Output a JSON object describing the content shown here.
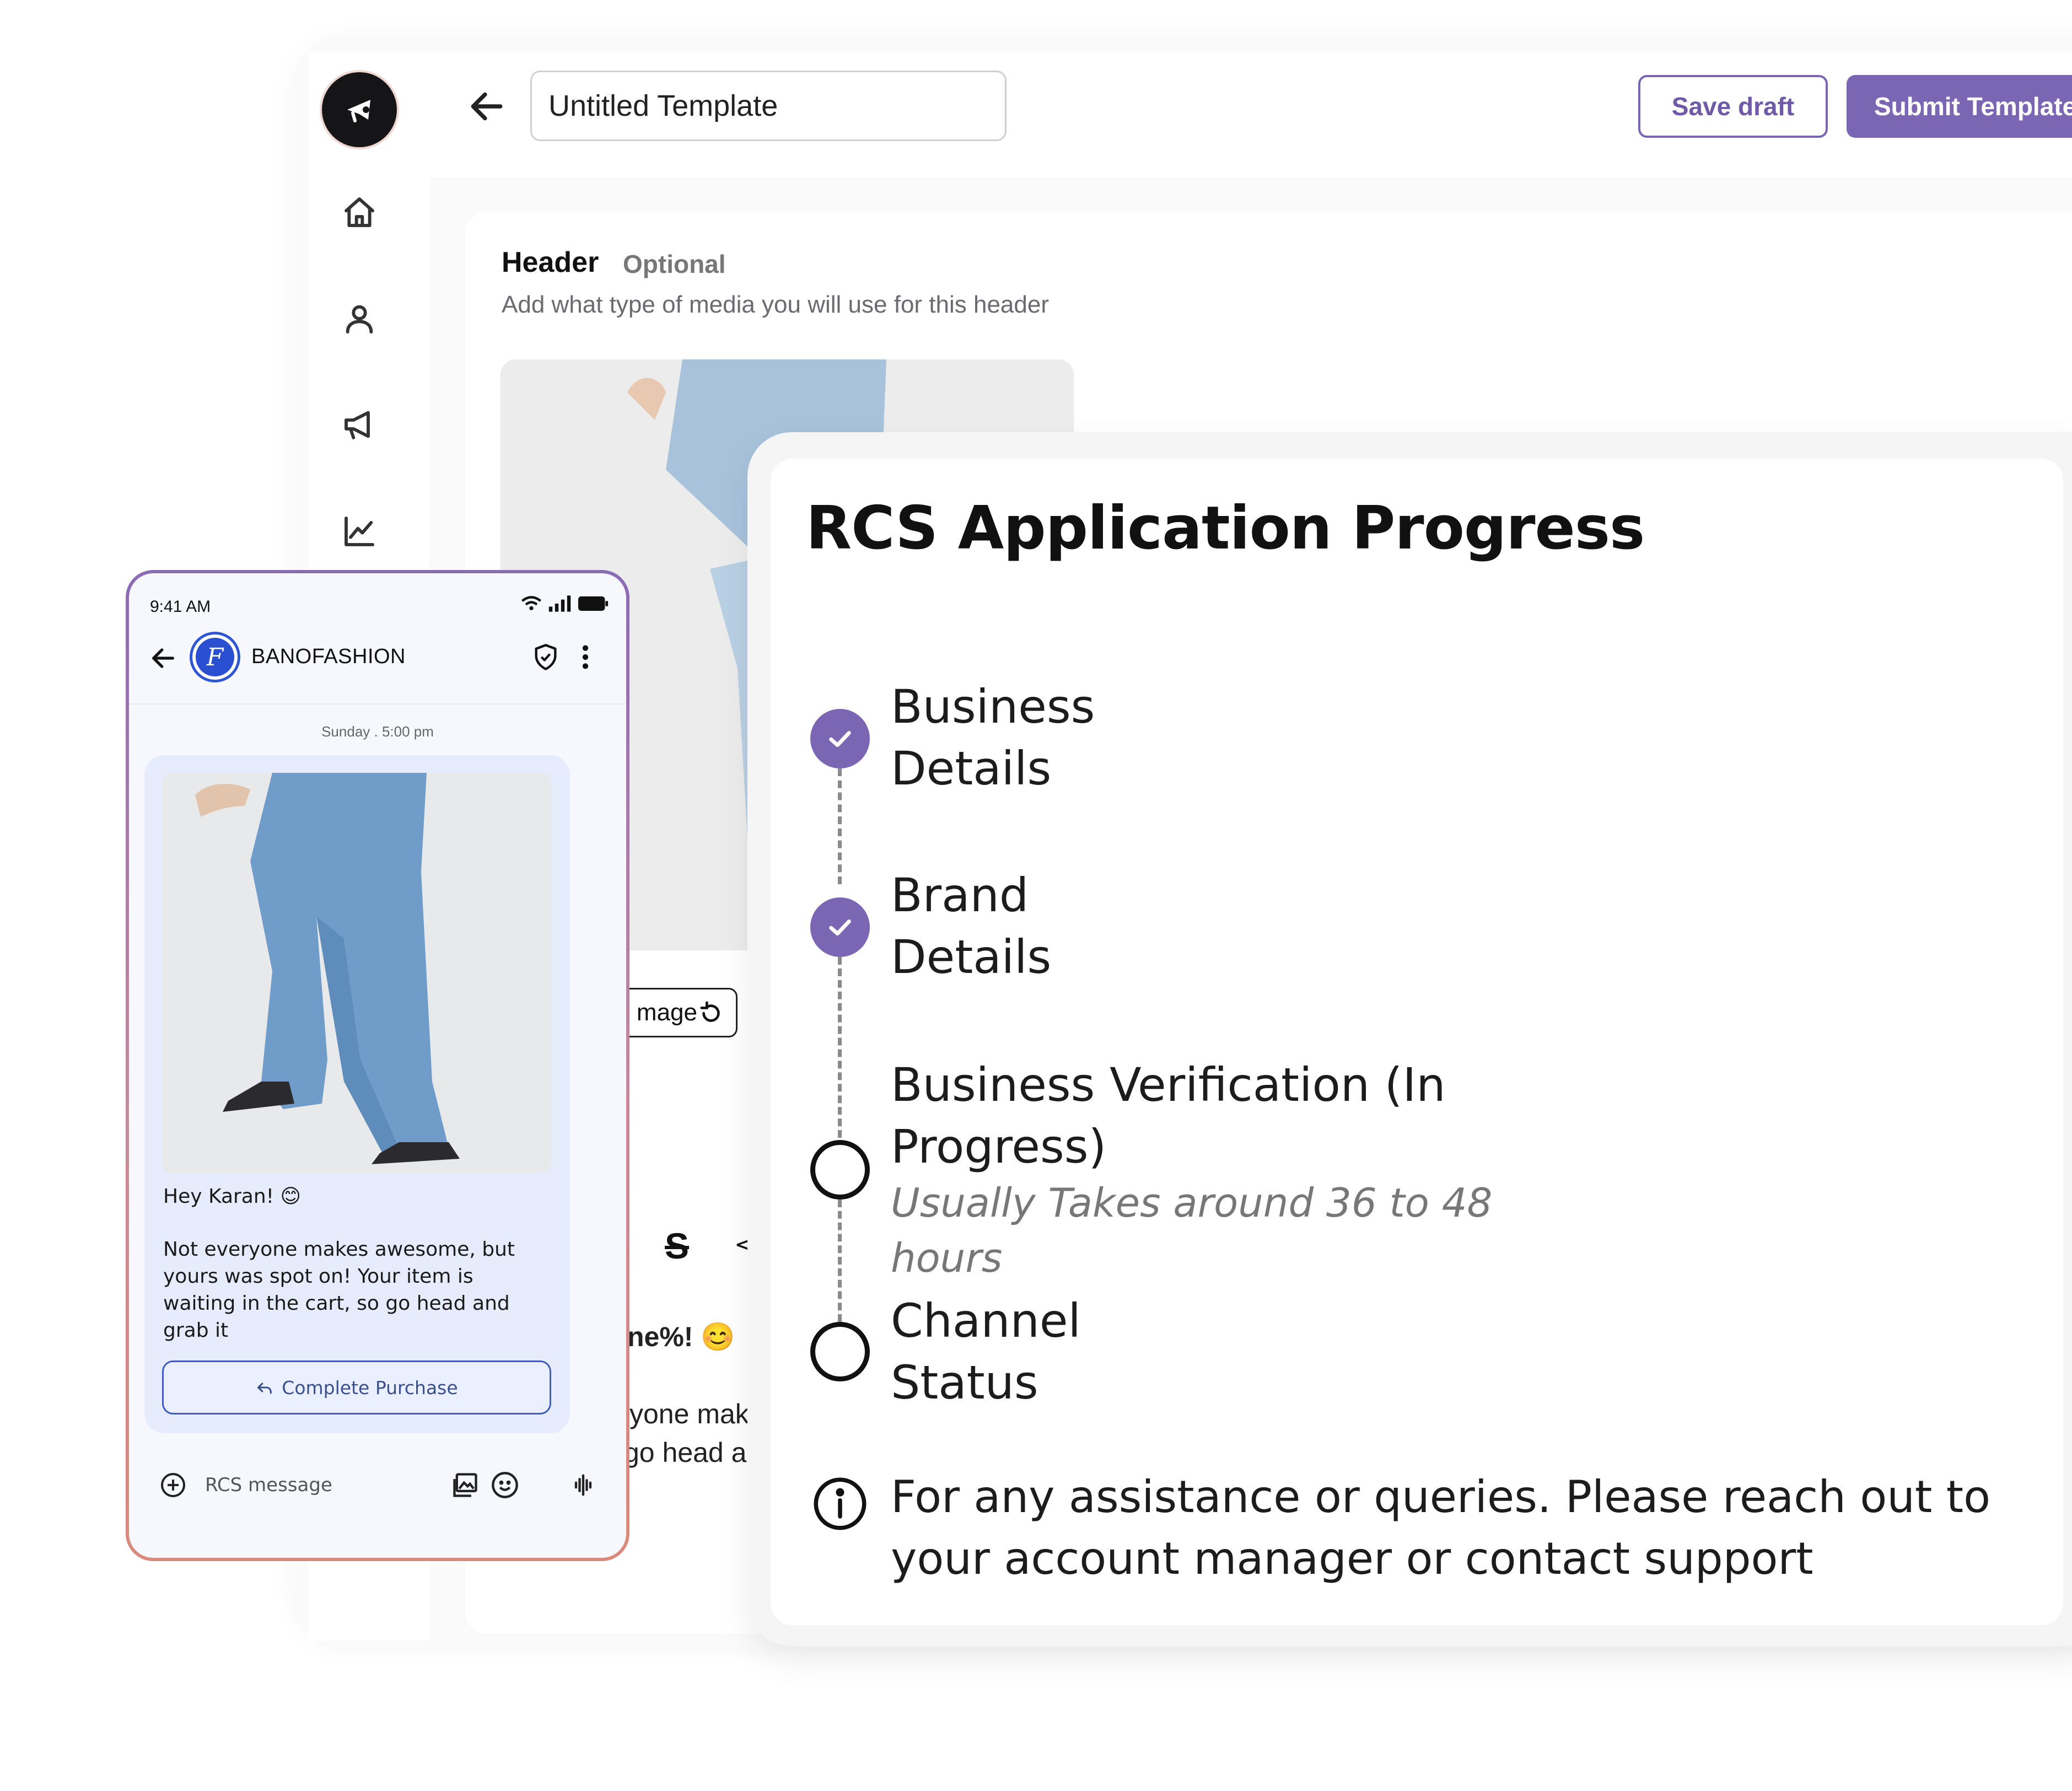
{
  "app": {
    "title_input_value": "Untitled Template",
    "save_draft_label": "Save draft",
    "submit_template_label": "Submit Template",
    "sidebar_icons": [
      "home-icon",
      "user-icon",
      "megaphone-icon",
      "analytics-icon"
    ],
    "accent_color": "#7b66b3"
  },
  "editor": {
    "header_title": "Header",
    "header_optional": "Optional",
    "header_subtitle": "Add what type of media you will use for this header",
    "replace_image_fragment": "mage",
    "body_fragment_1": "ne%!",
    "body_fragment_2": "yone mak",
    "body_fragment_3": "go head a"
  },
  "phone": {
    "time": "9:41 AM",
    "brand_name": "BANOFASHION",
    "date_label": "Sunday . 5:00 pm",
    "greeting": "Hey Karan! 😊",
    "message_body": "Not everyone makes awesome, but yours was spot on! Your item is waiting in the cart, so go head and grab it",
    "cta_label": "Complete Purchase",
    "compose_placeholder": "RCS message"
  },
  "progress": {
    "title": "RCS Application Progress",
    "steps": [
      {
        "label": "Business Details",
        "line1": "Business",
        "line2": "Details",
        "status": "done"
      },
      {
        "label": "Brand Details",
        "line1": "Brand",
        "line2": "Details",
        "status": "done"
      },
      {
        "label": "Business Verification (In Progress)",
        "line1": "Business Verification (In",
        "line2": "Progress)",
        "status": "in-progress",
        "note_line1": "Usually Takes around 36 to 48",
        "note_line2": "hours"
      },
      {
        "label": "Channel Status",
        "line1": "Channel",
        "line2": "Status",
        "status": "pending"
      }
    ],
    "info_line1": "For any assistance or queries. Please reach out to",
    "info_line2": "your account manager or contact support"
  }
}
